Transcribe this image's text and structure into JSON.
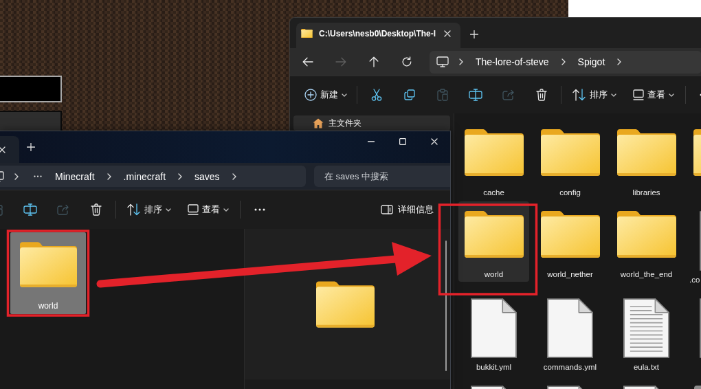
{
  "back_window": {
    "tabs": [
      {
        "title": "C:\\Users\\nesb0\\Desktop\\The-l",
        "selected": true
      }
    ],
    "nav_buttons": [
      {
        "kind": "back",
        "disabled": false
      },
      {
        "kind": "forward",
        "disabled": true
      },
      {
        "kind": "up",
        "disabled": false
      },
      {
        "kind": "refresh",
        "disabled": false
      }
    ],
    "breadcrumbs": [
      "The-lore-of-steve",
      "Spigot"
    ],
    "commands": [
      {
        "kind": "new",
        "label": "新建",
        "disabled": false
      },
      {
        "kind": "cut",
        "disabled": false
      },
      {
        "kind": "copy",
        "disabled": false
      },
      {
        "kind": "paste",
        "disabled": true
      },
      {
        "kind": "rename",
        "disabled": false
      },
      {
        "kind": "share",
        "disabled": true
      },
      {
        "kind": "delete",
        "disabled": false
      },
      {
        "kind": "sort",
        "label": "排序",
        "disabled": false
      },
      {
        "kind": "view",
        "label": "查看",
        "disabled": false
      },
      {
        "kind": "more",
        "disabled": false
      }
    ],
    "sidebar": {
      "items": [
        {
          "label": "主文件夹",
          "selected": true
        }
      ]
    },
    "items": [
      {
        "name": "cache",
        "kind": "folder",
        "selected": false
      },
      {
        "name": "config",
        "kind": "folder",
        "selected": false
      },
      {
        "name": "libraries",
        "kind": "folder",
        "selected": false
      },
      {
        "kind": "folder",
        "selected": false
      },
      {
        "name": "world",
        "kind": "folder",
        "selected": true
      },
      {
        "name": "world_nether",
        "kind": "folder",
        "selected": false
      },
      {
        "name": "world_the_end",
        "kind": "folder",
        "selected": false
      },
      {
        "name": ".co",
        "kind": "file",
        "selected": false
      },
      {
        "name": "bukkit.yml",
        "kind": "file",
        "selected": false
      },
      {
        "name": "commands.yml",
        "kind": "file",
        "selected": false
      },
      {
        "name": "eula.txt",
        "kind": "text_file",
        "selected": false
      },
      {
        "kind": "file",
        "selected": false
      },
      {
        "kind": "file",
        "selected": false
      },
      {
        "kind": "file",
        "selected": false
      },
      {
        "kind": "text_file",
        "selected": false
      },
      {
        "kind": "package",
        "selected": false
      }
    ]
  },
  "front_window": {
    "tabs": [
      {
        "selected": true
      }
    ],
    "breadcrumb_overflow": true,
    "breadcrumbs": [
      "Minecraft",
      ".minecraft",
      "saves"
    ],
    "search": {
      "placeholder": "在 saves 中搜索"
    },
    "commands": [
      {
        "kind": "paste",
        "disabled": true
      },
      {
        "kind": "rename",
        "disabled": false
      },
      {
        "kind": "share",
        "disabled": true
      },
      {
        "kind": "delete",
        "disabled": false
      },
      {
        "kind": "sort",
        "label": "排序",
        "disabled": false
      },
      {
        "kind": "view",
        "label": "查看",
        "disabled": false
      },
      {
        "kind": "more",
        "disabled": false
      },
      {
        "kind": "details",
        "label": "详细信息",
        "disabled": false
      }
    ],
    "items": [
      {
        "name": "world",
        "kind": "folder",
        "selected": true
      }
    ],
    "preview": {
      "kind": "folder"
    }
  }
}
